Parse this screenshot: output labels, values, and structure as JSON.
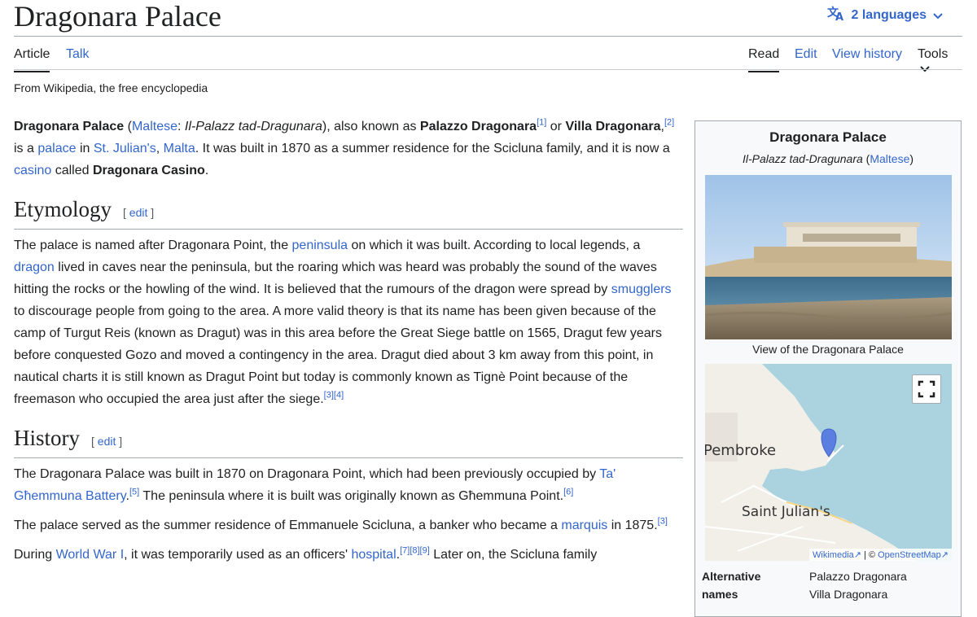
{
  "page": {
    "title": "Dragonara Palace",
    "languages": "2 languages",
    "tabs_left": [
      "Article",
      "Talk"
    ],
    "tabs_right": [
      "Read",
      "Edit",
      "View history",
      "Tools"
    ],
    "from": "From Wikipedia, the free encyclopedia"
  },
  "intro": {
    "t1": "Dragonara Palace",
    "t2": " (",
    "l1": "Maltese",
    "t3": ": ",
    "t4": "Il-Palazz tad-Dragunara",
    "t5": "), also known as ",
    "t6": "Palazzo Dragonara",
    "r1": "[1]",
    "t7": " or ",
    "t8": "Villa Dragonara",
    "t9": ",",
    "r2": "[2]",
    "t10": " is a ",
    "l2": "palace",
    "t11": " in ",
    "l3": "St. Julian's",
    "t12": ", ",
    "l4": "Malta",
    "t13": ". It was built in 1870 as a summer residence for the Scicluna family, and it is now a ",
    "l5": "casino",
    "t14": " called ",
    "t15": "Dragonara Casino",
    "t16": "."
  },
  "etymology": {
    "heading": "Etymology",
    "edit": "edit",
    "t1": "The palace is named after Dragonara Point, the ",
    "l1": "peninsula",
    "t2": " on which it was built. According to local legends, a ",
    "l2": "dragon",
    "t3": " lived in caves near the peninsula, but the roaring which was heard was probably the sound of the waves hitting the rocks or the howling of the wind. It is believed that the rumours of the dragon were spread by ",
    "l3": "smugglers",
    "t4": " to discourage people from going to the area. A more valid theory is that its name has been given because of the camp of Turgut Reis (known as Dragut) was in this area before the Great Siege battle on 1565, Dragut few years before conquested Gozo and moved a contingency in the area. Dragut died about 3 km away from this point, in nautical charts it is still known as Dragut Point but today is commonly known as Tignè Point because of the freemason who occupied the area just after the siege.",
    "r1": "[3]",
    "r2": "[4]"
  },
  "history": {
    "heading": "History",
    "edit": "edit",
    "p1_t1": "The Dragonara Palace was built in 1870 on Dragonara Point, which had been previously occupied by ",
    "p1_l1": "Ta' Għemmuna Battery",
    "p1_t2": ".",
    "p1_r1": "[5]",
    "p1_t3": " The peninsula where it is built was originally known as Għemmuna Point.",
    "p1_r2": "[6]",
    "p2_t1": "The palace served as the summer residence of Emmanuele Scicluna, a banker who became a ",
    "p2_l1": "marquis",
    "p2_t2": " in 1875.",
    "p2_r1": "[3]",
    "p3_t1": "During ",
    "p3_l1": "World War I",
    "p3_t2": ", it was temporarily used as an officers' ",
    "p3_l2": "hospital",
    "p3_t3": ".",
    "p3_r1": "[7]",
    "p3_r2": "[8]",
    "p3_r3": "[9]",
    "p3_t4": " Later on, the Scicluna family"
  },
  "infobox": {
    "title": "Dragonara Palace",
    "native": "Il-Palazz tad-Dragunara",
    "native_open": " (",
    "native_lang": "Maltese",
    "native_close": ")",
    "caption": "View of the Dragonara Palace",
    "map_labels": [
      "Pembroke",
      "Saint Julian's"
    ],
    "map_attr_1": "Wikimedia",
    "map_attr_sep": " | © ",
    "map_attr_2": "OpenStreetMap",
    "rows": [
      {
        "label": "Alternative names",
        "values": [
          "Palazzo Dragonara",
          "Villa Dragonara"
        ]
      }
    ]
  },
  "colors": {
    "link": "#3366cc",
    "border": "#a2a9b1",
    "marker": "#5b7fe0"
  },
  "icons": [
    "translate-icon",
    "chevron-down-icon",
    "fullscreen-icon",
    "map-marker-icon",
    "external-link-icon"
  ]
}
